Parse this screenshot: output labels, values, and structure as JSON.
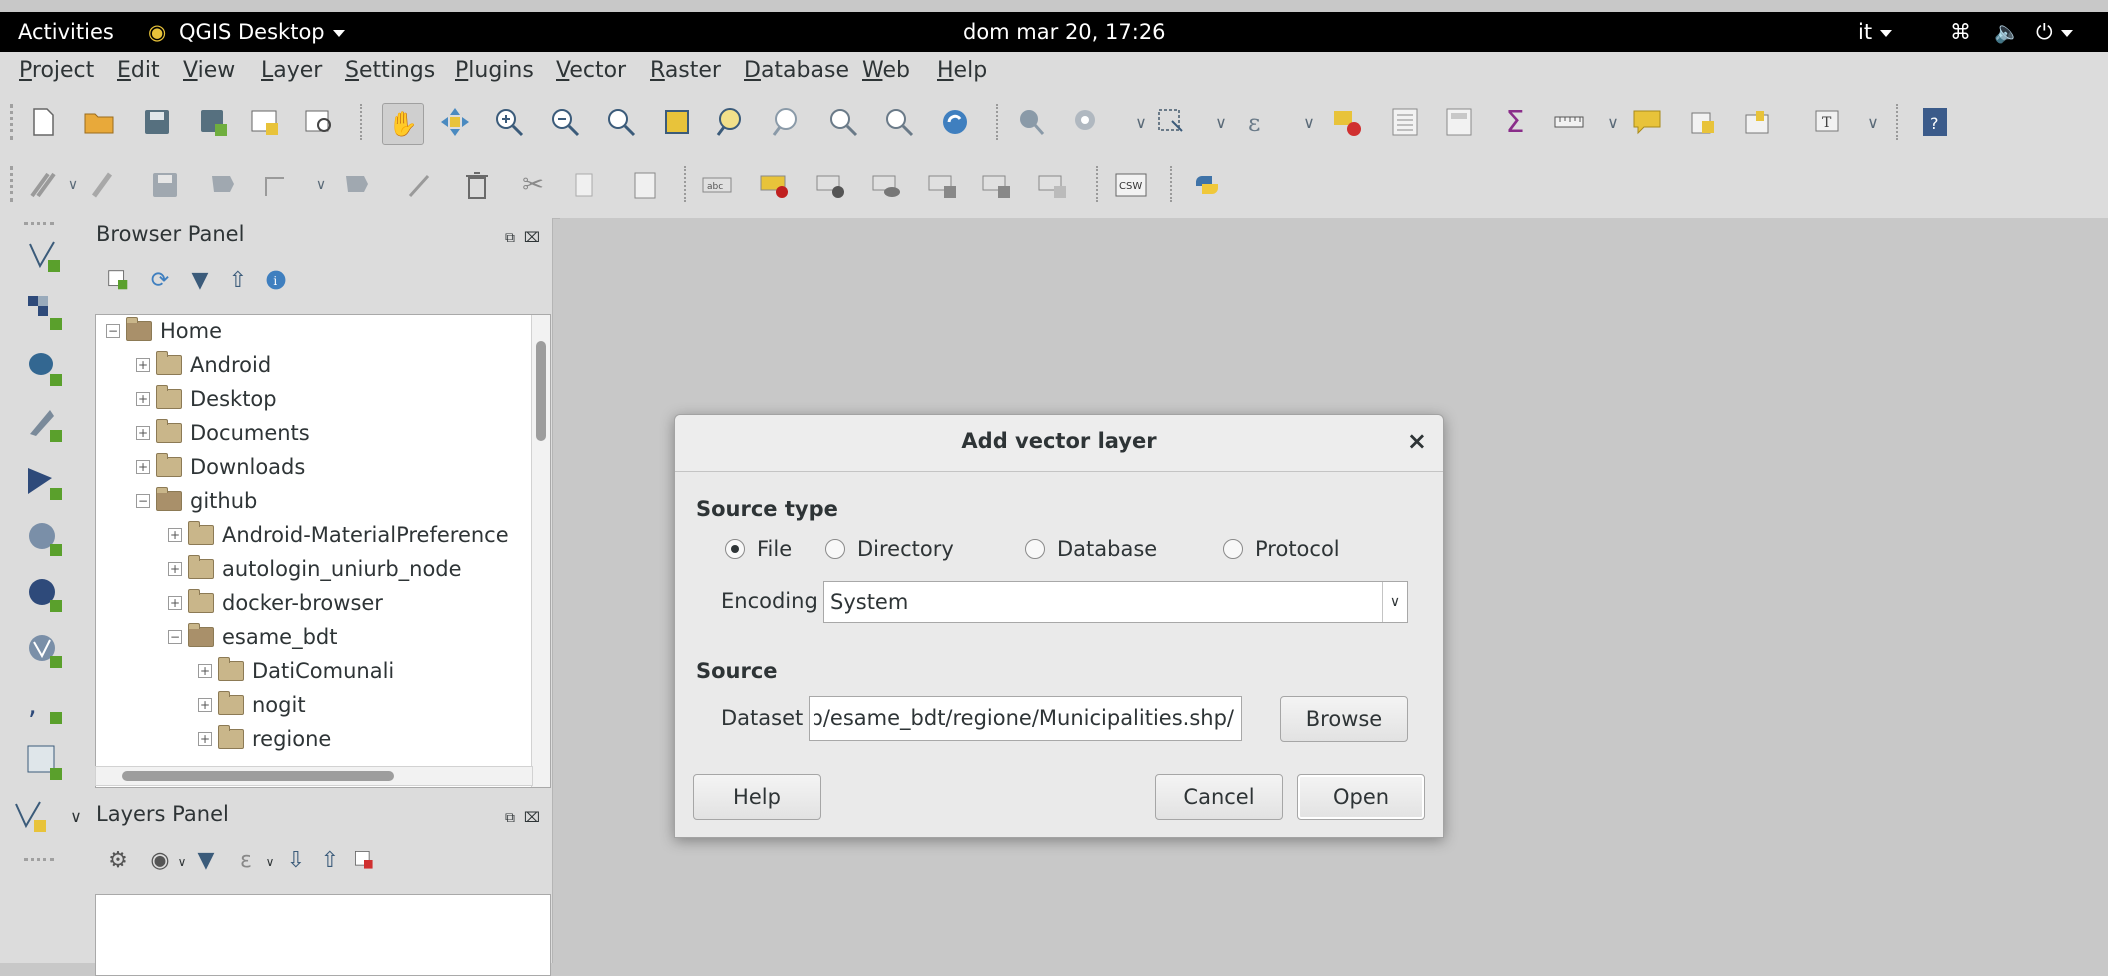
{
  "topbar": {
    "activities": "Activities",
    "app": "QGIS Desktop",
    "clock": "dom mar 20, 17:26",
    "lang": "it"
  },
  "menu": [
    "Project",
    "Edit",
    "View",
    "Layer",
    "Settings",
    "Plugins",
    "Vector",
    "Raster",
    "Database",
    "Web",
    "Help"
  ],
  "toolbar2": {
    "csw": "CSW"
  },
  "browser": {
    "title": "Browser Panel",
    "tree": [
      {
        "label": "Home"
      },
      {
        "label": "Android"
      },
      {
        "label": "Desktop"
      },
      {
        "label": "Documents"
      },
      {
        "label": "Downloads"
      },
      {
        "label": "github"
      },
      {
        "label": "Android-MaterialPreference"
      },
      {
        "label": "autologin_uniurb_node"
      },
      {
        "label": "docker-browser"
      },
      {
        "label": "esame_bdt"
      },
      {
        "label": "DatiComunali"
      },
      {
        "label": "nogit"
      },
      {
        "label": "regione"
      }
    ]
  },
  "layers": {
    "title": "Layers Panel"
  },
  "dialog": {
    "title": "Add vector layer",
    "source_type_label": "Source type",
    "radios": [
      "File",
      "Directory",
      "Database",
      "Protocol"
    ],
    "selected_radio": "File",
    "encoding_label": "Encoding",
    "encoding_value": "System",
    "source_label": "Source",
    "dataset_label": "Dataset",
    "dataset_value": "/github/esame_bdt/regione/Municipalities.shp",
    "browse": "Browse",
    "help": "Help",
    "cancel": "Cancel",
    "open": "Open"
  },
  "colors": {
    "topbar_bg": "#000000",
    "window_bg": "#dcdcdc",
    "canvas_bg": "#c8c8c8",
    "accent_yellow": "#e8c33a",
    "sum_purple": "#8a2d8a"
  }
}
